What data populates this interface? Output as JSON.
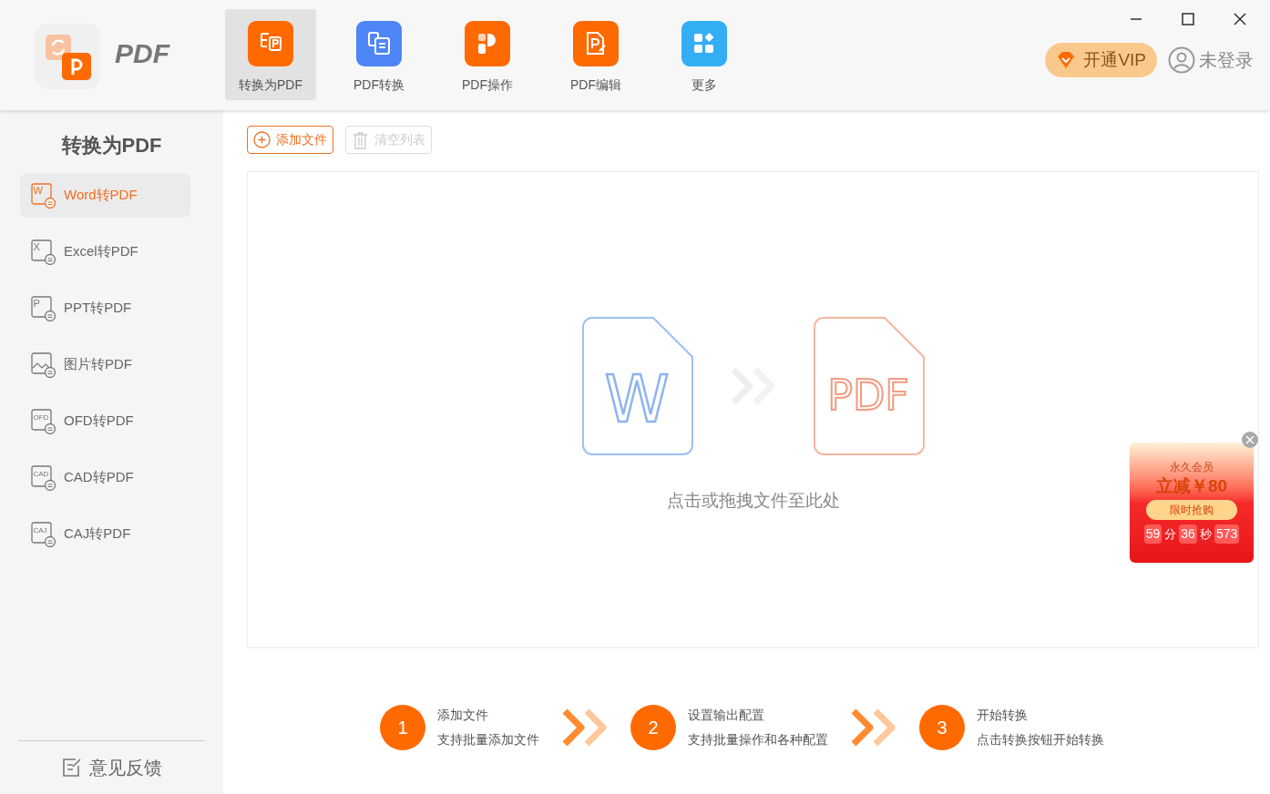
{
  "app": {
    "logo_text": "PDF"
  },
  "tabs": [
    {
      "label": "转换为PDF",
      "selected": true,
      "kind": "to-pdf",
      "color": "#ff6a00"
    },
    {
      "label": "PDF转换",
      "selected": false,
      "kind": "from-pdf",
      "color": "#4e86f7"
    },
    {
      "label": "PDF操作",
      "selected": false,
      "kind": "operate",
      "color": "#ff6a00"
    },
    {
      "label": "PDF编辑",
      "selected": false,
      "kind": "edit",
      "color": "#ff6a00"
    },
    {
      "label": "更多",
      "selected": false,
      "kind": "more",
      "color": "#33aef5"
    }
  ],
  "header": {
    "vip_button": "开通VIP",
    "login": "未登录"
  },
  "sidebar": {
    "title": "转换为PDF",
    "items": [
      {
        "label": "Word转PDF",
        "selected": true,
        "badge": "W"
      },
      {
        "label": "Excel转PDF",
        "selected": false,
        "badge": "X"
      },
      {
        "label": "PPT转PDF",
        "selected": false,
        "badge": "P"
      },
      {
        "label": "图片转PDF",
        "selected": false
      },
      {
        "label": "OFD转PDF",
        "selected": false,
        "badge": "OFD"
      },
      {
        "label": "CAD转PDF",
        "selected": false,
        "badge": "CAD"
      },
      {
        "label": "CAJ转PDF",
        "selected": false,
        "badge": "CAJ"
      }
    ],
    "feedback": "意见反馈"
  },
  "toolbar": {
    "add_button": {
      "label": "添加文件",
      "disabled": false
    },
    "clear_button": {
      "label": "清空列表",
      "disabled": true
    }
  },
  "dropzone": {
    "source_letter": "W",
    "target_label": "PDF",
    "hint": "点击或拖拽文件至此处"
  },
  "promo": {
    "title": "永久会员",
    "offer": "立减￥80",
    "button": "限时抢购",
    "countdown": [
      {
        "value": "59",
        "unit": "分"
      },
      {
        "value": "36",
        "unit": "秒"
      },
      {
        "value": "573"
      }
    ]
  },
  "steps": [
    {
      "number": "1",
      "title": "添加文件",
      "desc": "支持批量添加文件"
    },
    {
      "number": "2",
      "title": "设置输出配置",
      "desc": "支持批量操作和各种配置"
    },
    {
      "number": "3",
      "title": "开始转换",
      "desc": "点击转换按钮开始转换"
    }
  ]
}
